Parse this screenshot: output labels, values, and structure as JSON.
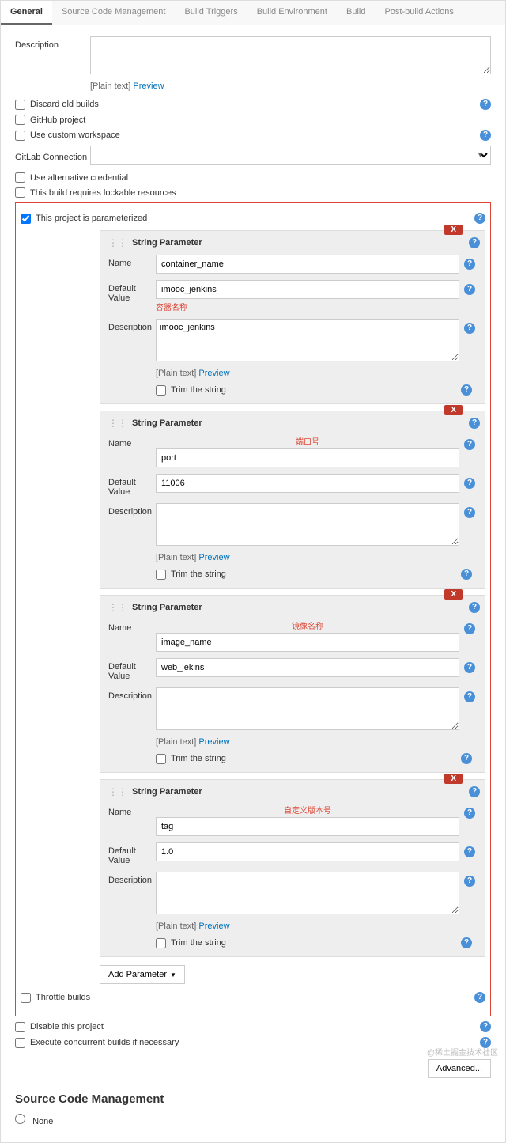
{
  "tabs": [
    "General",
    "Source Code Management",
    "Build Triggers",
    "Build Environment",
    "Build",
    "Post-build Actions"
  ],
  "description_label": "Description",
  "plain_text": "[Plain text]",
  "preview": "Preview",
  "checks": {
    "discard": "Discard old builds",
    "github": "GitHub project",
    "workspace": "Use custom workspace",
    "alt_cred": "Use alternative credential",
    "lockable": "This build requires lockable resources",
    "parameterized": "This project is parameterized",
    "throttle": "Throttle builds",
    "disable": "Disable this project",
    "concurrent": "Execute concurrent builds if necessary"
  },
  "gitlab_label": "GitLab Connection",
  "param_type": "String Parameter",
  "labels": {
    "name": "Name",
    "default_value": "Default Value",
    "description": "Description",
    "trim": "Trim the string"
  },
  "delete_label": "X",
  "params": [
    {
      "name": "container_name",
      "default": "imooc_jenkins",
      "desc": "imooc_jenkins",
      "annot": "容器名称",
      "annot_pos": "below-default"
    },
    {
      "name": "port",
      "default": "11006",
      "desc": "",
      "annot": "端口号",
      "annot_pos": "above-name"
    },
    {
      "name": "image_name",
      "default": "web_jekins",
      "desc": "",
      "annot": "镜像名称",
      "annot_pos": "above-name"
    },
    {
      "name": "tag",
      "default": "1.0",
      "desc": "",
      "annot": "自定义版本号",
      "annot_pos": "above-name"
    }
  ],
  "add_parameter": "Add Parameter",
  "advanced": "Advanced...",
  "scm_title": "Source Code Management",
  "scm_none": "None",
  "watermark": "@稀土掘金技术社区",
  "help_glyph": "?"
}
